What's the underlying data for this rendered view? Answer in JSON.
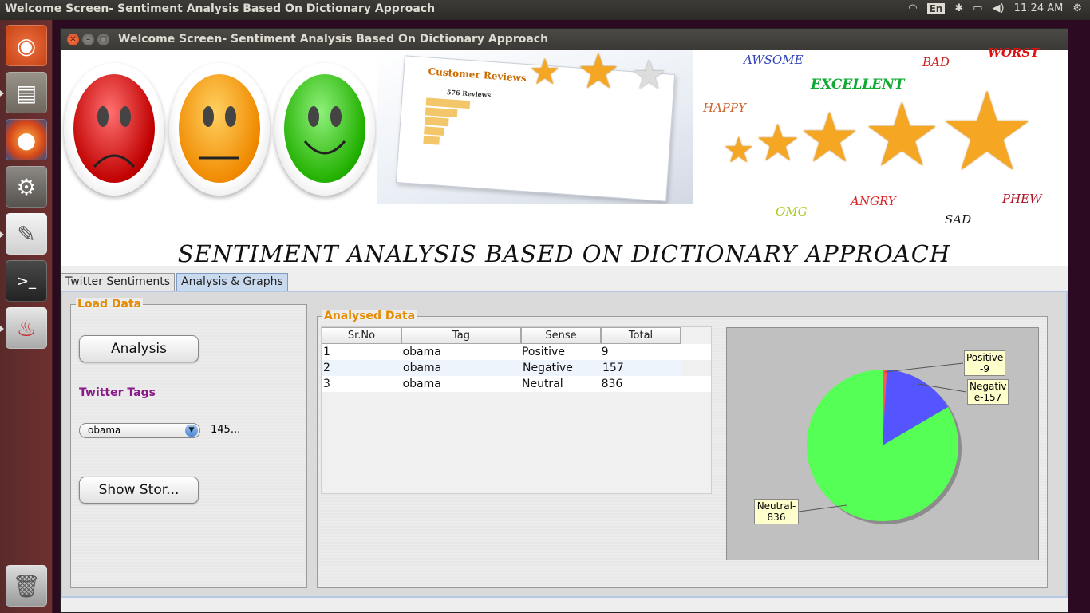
{
  "panel": {
    "window_title": "Welcome Screen- Sentiment Analysis Based On Dictionary Approach",
    "lang": "En",
    "time": "11:24 AM"
  },
  "launcher": {
    "items": [
      "ubuntu-dash",
      "files",
      "firefox",
      "system-settings",
      "text-editor",
      "terminal",
      "java",
      "trash"
    ]
  },
  "window": {
    "title": "Welcome Screen- Sentiment Analysis Based On Dictionary Approach"
  },
  "banner": {
    "title": "SENTIMENT ANALYSIS BASED ON DICTIONARY APPROACH",
    "reviews_heading": "Customer Reviews",
    "reviews_count": "576 Reviews",
    "words": [
      "AWSOME",
      "BAD",
      "WORST",
      "EXCELLENT",
      "HAPPY",
      "OMG",
      "ANGRY",
      "PHEW",
      "SAD"
    ]
  },
  "tabs": [
    {
      "label": "Twitter Sentiments",
      "active": false
    },
    {
      "label": "Analysis & Graphs",
      "active": true
    }
  ],
  "load_data": {
    "legend": "Load Data",
    "analysis_button": "Analysis",
    "tags_label": "Twitter Tags",
    "selected_tag": "obama",
    "tag_count": "145...",
    "show_button": "Show Stor..."
  },
  "analysed_data": {
    "legend": "Analysed Data",
    "columns": [
      "Sr.No",
      "Tag",
      "Sense",
      "Total"
    ],
    "rows": [
      [
        "1",
        "obama",
        "Positive",
        "9"
      ],
      [
        "2",
        "obama",
        "Negative",
        "157"
      ],
      [
        "3",
        "obama",
        "Neutral",
        "836"
      ]
    ]
  },
  "chart_data": {
    "type": "pie",
    "slices": [
      {
        "label": "Positive-9",
        "value": 9,
        "color": "#ff5555"
      },
      {
        "label": "Negative-157",
        "value": 157,
        "color": "#5555ff"
      },
      {
        "label": "Neutral-836",
        "value": 836,
        "color": "#55ff55"
      }
    ],
    "labels": {
      "positive": "Positive\n-9",
      "negative": "Negativ\ne-157",
      "neutral": "Neutral-\n836"
    }
  }
}
